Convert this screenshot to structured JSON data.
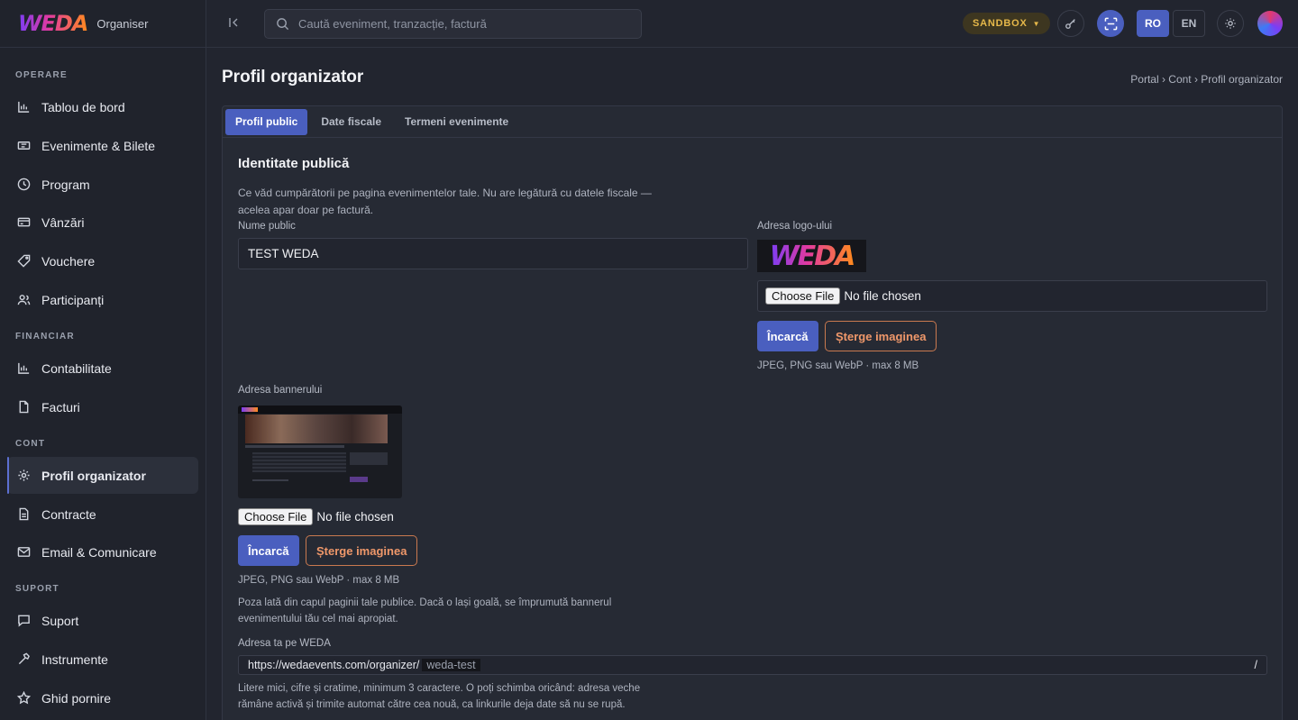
{
  "brand": {
    "logo_text": "WEDA",
    "subtitle": "Organiser"
  },
  "sidebar": {
    "sections": [
      {
        "title": "OPERARE",
        "items": [
          "Tablou de bord",
          "Evenimente & Bilete",
          "Program",
          "Vânzări",
          "Vouchere",
          "Participanți"
        ]
      },
      {
        "title": "FINANCIAR",
        "items": [
          "Contabilitate",
          "Facturi"
        ]
      },
      {
        "title": "CONT",
        "items": [
          "Profil organizator",
          "Contracte",
          "Email & Comunicare"
        ]
      },
      {
        "title": "SUPORT",
        "items": [
          "Suport",
          "Instrumente",
          "Ghid pornire"
        ]
      }
    ],
    "active_item": "Profil organizator"
  },
  "topbar": {
    "search_placeholder": "Caută eveniment, tranzacție, factură",
    "env_badge": "SANDBOX",
    "lang_ro": "RO",
    "lang_en": "EN",
    "active_lang": "RO"
  },
  "page": {
    "title": "Profil organizator",
    "breadcrumb": "Portal › Cont › Profil organizator"
  },
  "tabs": [
    "Profil public",
    "Date fiscale",
    "Termeni evenimente"
  ],
  "active_tab": "Profil public",
  "form": {
    "section_title": "Identitate publică",
    "section_desc_1": "Ce văd cumpărătorii pe pagina evenimentelor tale. Nu are legătură cu datele fiscale —",
    "section_desc_2": "acelea apar doar pe factură.",
    "public_name_label": "Nume public",
    "public_name_value": "TEST WEDA",
    "logo_label": "Adresa logo-ului",
    "logo_preview_text": "WEDA",
    "file_button": "Choose File",
    "file_status": "No file chosen",
    "upload_label": "Încarcă",
    "delete_label": "Șterge imaginea",
    "file_hint": "JPEG, PNG sau WebP · max 8 MB",
    "banner_label": "Adresa bannerului",
    "banner_desc_1": "Poza lată din capul paginii tale publice. Dacă o lași goală, se împrumută bannerul",
    "banner_desc_2": "evenimentului tău cel mai apropiat.",
    "url_label": "Adresa ta pe WEDA",
    "url_prefix": "https://wedaevents.com/organizer/",
    "url_slug": "weda-test",
    "url_suffix": "/",
    "url_desc_1": "Litere mici, cifre și cratime, minimum 3 caractere. O poți schimba oricând: adresa veche",
    "url_desc_2": "rămâne activă și trimite automat către cea nouă, ca linkurile deja date să nu se rupă."
  },
  "colors": {
    "accent": "#4a5fbf",
    "danger": "#f0986a",
    "sandbox": "#e6b84a",
    "background": "#22252f"
  }
}
